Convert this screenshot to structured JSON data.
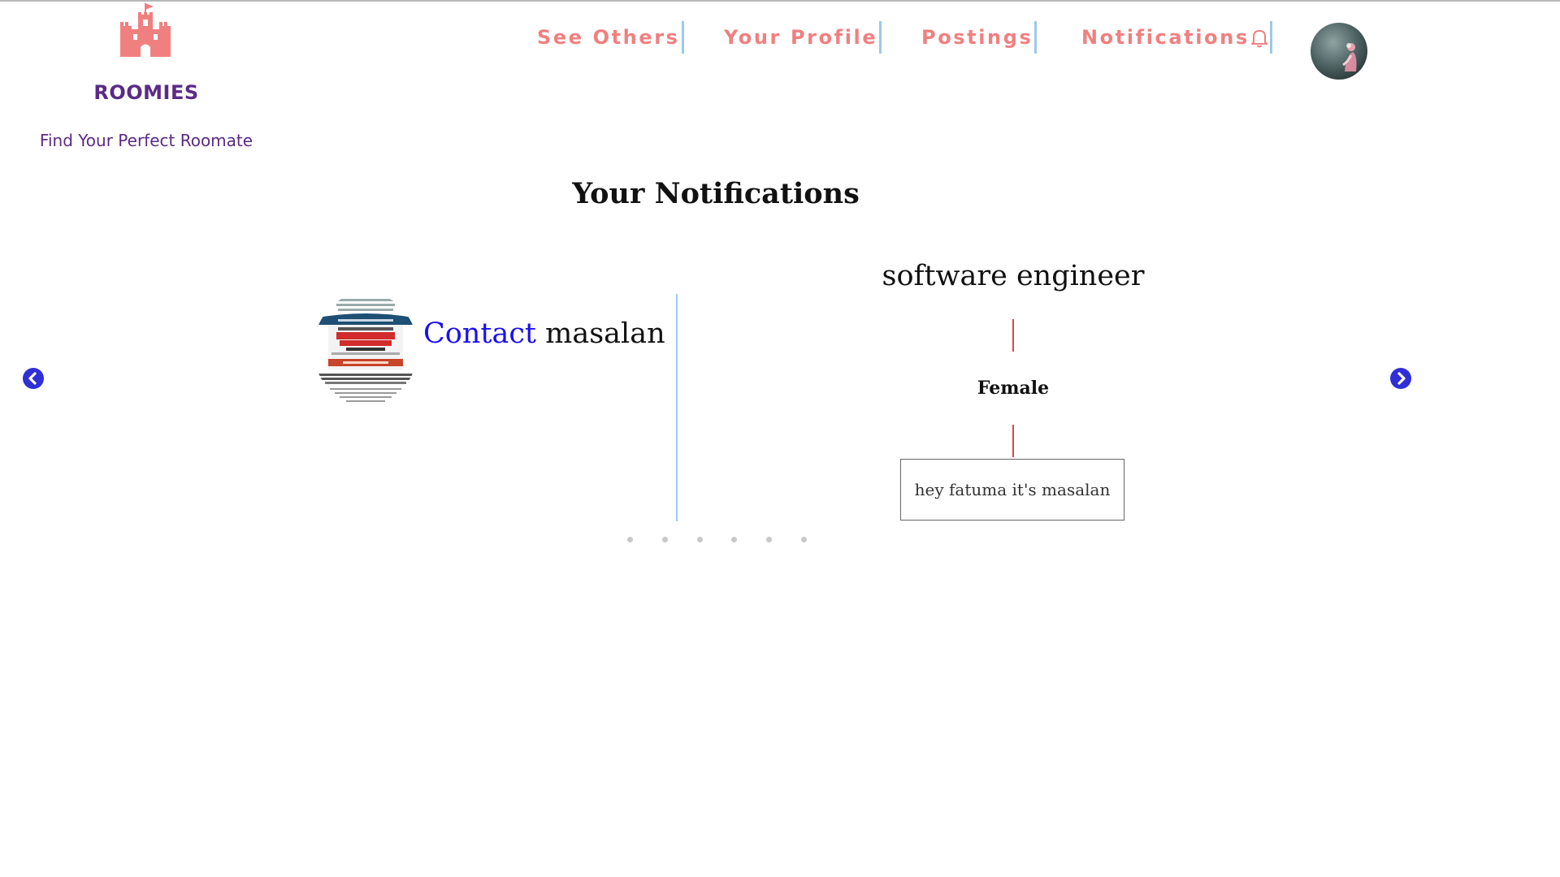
{
  "brand": {
    "name": "ROOMIES",
    "tagline": "Find Your Perfect Roomate",
    "logo_icon": "castle-icon",
    "color": "#5b2a86",
    "logo_color": "#f08080"
  },
  "nav": {
    "items": [
      {
        "label": "See Others"
      },
      {
        "label": "Your Profile"
      },
      {
        "label": "Postings"
      },
      {
        "label": "Notifications",
        "icon": "bell-icon"
      }
    ],
    "color": "#f08080",
    "separator_color": "#9ec9e6"
  },
  "avatar": {
    "icon": "user-avatar"
  },
  "page": {
    "title": "Your Notifications"
  },
  "notification": {
    "contact_link": "Contact",
    "contact_name": "masalan",
    "thumbnail": "book-cover-thumbnail",
    "job_title": "software engineer",
    "gender": "Female",
    "message": "hey fatuma it's masalan",
    "link_color": "#1a0ff0",
    "accent_color": "#e0454d"
  },
  "carousel": {
    "dot_count": 6,
    "prev_icon": "chevron-left-circle-icon",
    "next_icon": "chevron-right-circle-icon",
    "arrow_color": "#2f2fd8"
  }
}
